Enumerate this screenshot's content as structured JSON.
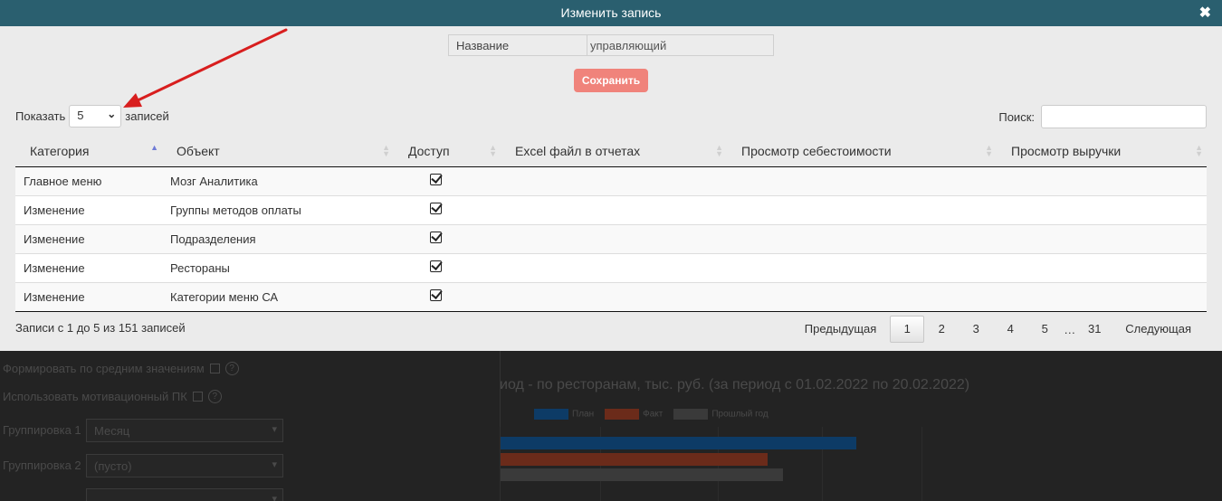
{
  "modal": {
    "title": "Изменить запись",
    "close_glyph": "✖",
    "name_label": "Название",
    "name_value": "управляющий",
    "save_label": "Сохранить"
  },
  "table_controls": {
    "show_prefix": "Показать",
    "page_length": "5",
    "show_suffix": "записей",
    "search_label": "Поиск:",
    "search_value": ""
  },
  "table": {
    "columns": [
      "Категория",
      "Объект",
      "Доступ",
      "Excel файл в отчетах",
      "Просмотр себестоимости",
      "Просмотр выручки"
    ],
    "rows": [
      {
        "category": "Главное меню",
        "object": "Мозг Аналитика",
        "access": true
      },
      {
        "category": "Изменение",
        "object": "Группы методов оплаты",
        "access": true
      },
      {
        "category": "Изменение",
        "object": "Подразделения",
        "access": true
      },
      {
        "category": "Изменение",
        "object": "Рестораны",
        "access": true
      },
      {
        "category": "Изменение",
        "object": "Категории меню СА",
        "access": true
      }
    ]
  },
  "footer": {
    "info": "Записи с 1 до 5 из 151 записей",
    "prev": "Предыдущая",
    "pages": [
      "1",
      "2",
      "3",
      "4",
      "5"
    ],
    "ellipsis": "…",
    "last_page": "31",
    "next": "Следующая",
    "current_page": "1"
  },
  "background": {
    "option1": "Формировать по средним значениям",
    "option2": "Использовать мотивационный ПК",
    "group1_label": "Группировка 1",
    "group1_value": "Месяц",
    "group2_label": "Группировка 2",
    "group2_value": "(пусто)",
    "chart_title": "иод - по ресторанам, тыс. руб. (за период с 01.02.2022 по 20.02.2022)",
    "legend": [
      {
        "name": "План",
        "color": "#0d3b66"
      },
      {
        "name": "Факт",
        "color": "#6b2b1a"
      },
      {
        "name": "Прошлый год",
        "color": "#3a3a3a"
      }
    ]
  },
  "colors": {
    "header": "#2a5f6f",
    "save_button": "#f0837b",
    "annotation_arrow": "#d81e1e"
  }
}
